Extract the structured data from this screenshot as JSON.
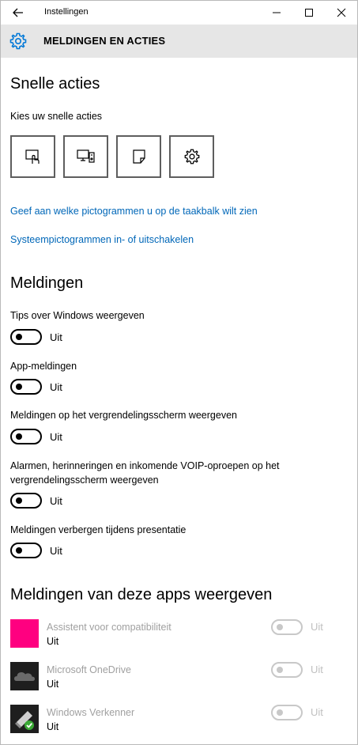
{
  "window": {
    "title": "Instellingen",
    "header_title": "MELDINGEN EN ACTIES"
  },
  "quick_actions": {
    "heading": "Snelle acties",
    "subheading": "Kies uw snelle acties",
    "buttons": [
      {
        "icon": "tablet-mode-icon"
      },
      {
        "icon": "project-icon"
      },
      {
        "icon": "note-icon"
      },
      {
        "icon": "settings-gear-icon"
      }
    ],
    "links": [
      "Geef aan welke pictogrammen u op de taakbalk wilt zien",
      "Systeempictogrammen in- of uitschakelen"
    ]
  },
  "notifications": {
    "heading": "Meldingen",
    "settings": [
      {
        "label": "Tips over Windows weergeven",
        "state": "Uit"
      },
      {
        "label": "App-meldingen",
        "state": "Uit"
      },
      {
        "label": "Meldingen op het vergrendelingsscherm weergeven",
        "state": "Uit"
      },
      {
        "label": "Alarmen, herinneringen en inkomende VOIP-oproepen op het",
        "label_line2": "vergrendelingsscherm weergeven",
        "state": "Uit"
      },
      {
        "label": "Meldingen verbergen tijdens presentatie",
        "state": "Uit"
      }
    ]
  },
  "apps": {
    "heading": "Meldingen van deze apps weergeven",
    "items": [
      {
        "name": "Assistent voor compatibiliteit",
        "state": "Uit",
        "toggle_state": "Uit",
        "icon_color": "#ff0080"
      },
      {
        "name": "Microsoft OneDrive",
        "state": "Uit",
        "toggle_state": "Uit",
        "icon_color": "#1e1e1e"
      },
      {
        "name": "Windows Verkenner",
        "state": "Uit",
        "toggle_state": "Uit",
        "icon_color": "#1e1e1e"
      }
    ]
  },
  "colors": {
    "link": "#0067b8",
    "header_band": "#e6e6e6",
    "accent": "#0078d7"
  }
}
